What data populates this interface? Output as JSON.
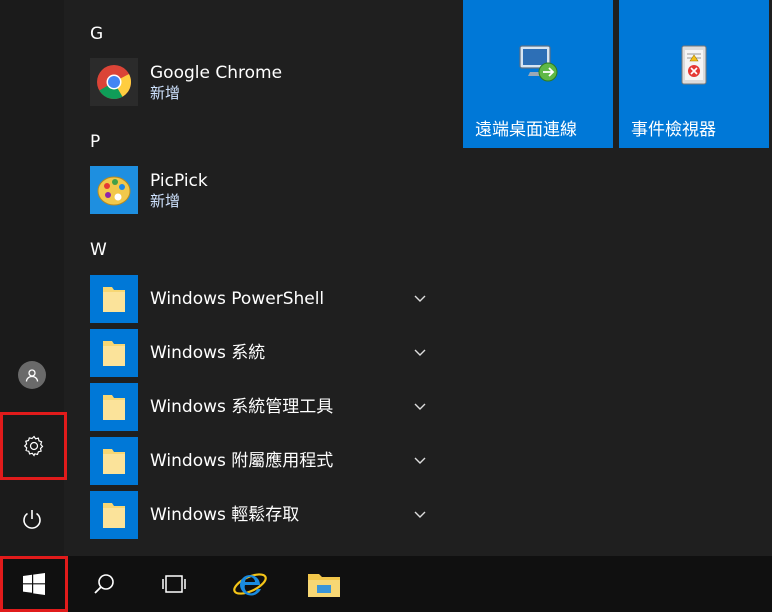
{
  "app_list": {
    "sections": [
      {
        "letter": "G",
        "apps": [
          {
            "name": "Google Chrome",
            "sub": "新增",
            "icon": "chrome-icon"
          }
        ]
      },
      {
        "letter": "P",
        "apps": [
          {
            "name": "PicPick",
            "sub": "新增",
            "icon": "picpick-icon"
          }
        ]
      },
      {
        "letter": "W",
        "apps": [
          {
            "name": "Windows PowerShell",
            "icon": "folder-icon",
            "expandable": true
          },
          {
            "name": "Windows 系統",
            "icon": "folder-icon",
            "expandable": true
          },
          {
            "name": "Windows 系統管理工具",
            "icon": "folder-icon",
            "expandable": true
          },
          {
            "name": "Windows 附屬應用程式",
            "icon": "folder-icon",
            "expandable": true
          },
          {
            "name": "Windows 輕鬆存取",
            "icon": "folder-icon",
            "expandable": true
          }
        ]
      }
    ]
  },
  "tiles": [
    {
      "label": "遠端桌面連線",
      "icon": "remote-desktop-icon"
    },
    {
      "label": "事件檢視器",
      "icon": "event-viewer-icon"
    }
  ],
  "rail": [
    {
      "name": "user-account",
      "icon": "user-icon"
    },
    {
      "name": "settings",
      "icon": "gear-icon",
      "highlighted": true
    },
    {
      "name": "power",
      "icon": "power-icon"
    }
  ],
  "taskbar": [
    {
      "name": "start",
      "icon": "windows-logo-icon",
      "highlighted": true
    },
    {
      "name": "search",
      "icon": "search-icon"
    },
    {
      "name": "task-view",
      "icon": "task-view-icon"
    },
    {
      "name": "internet-explorer",
      "icon": "ie-icon"
    },
    {
      "name": "file-explorer",
      "icon": "folder-icon"
    }
  ],
  "colors": {
    "tile_blue": "#0078d7",
    "highlight_red": "#e11b1b",
    "menu_bg": "#1f1f1f",
    "taskbar_bg": "#101010"
  }
}
